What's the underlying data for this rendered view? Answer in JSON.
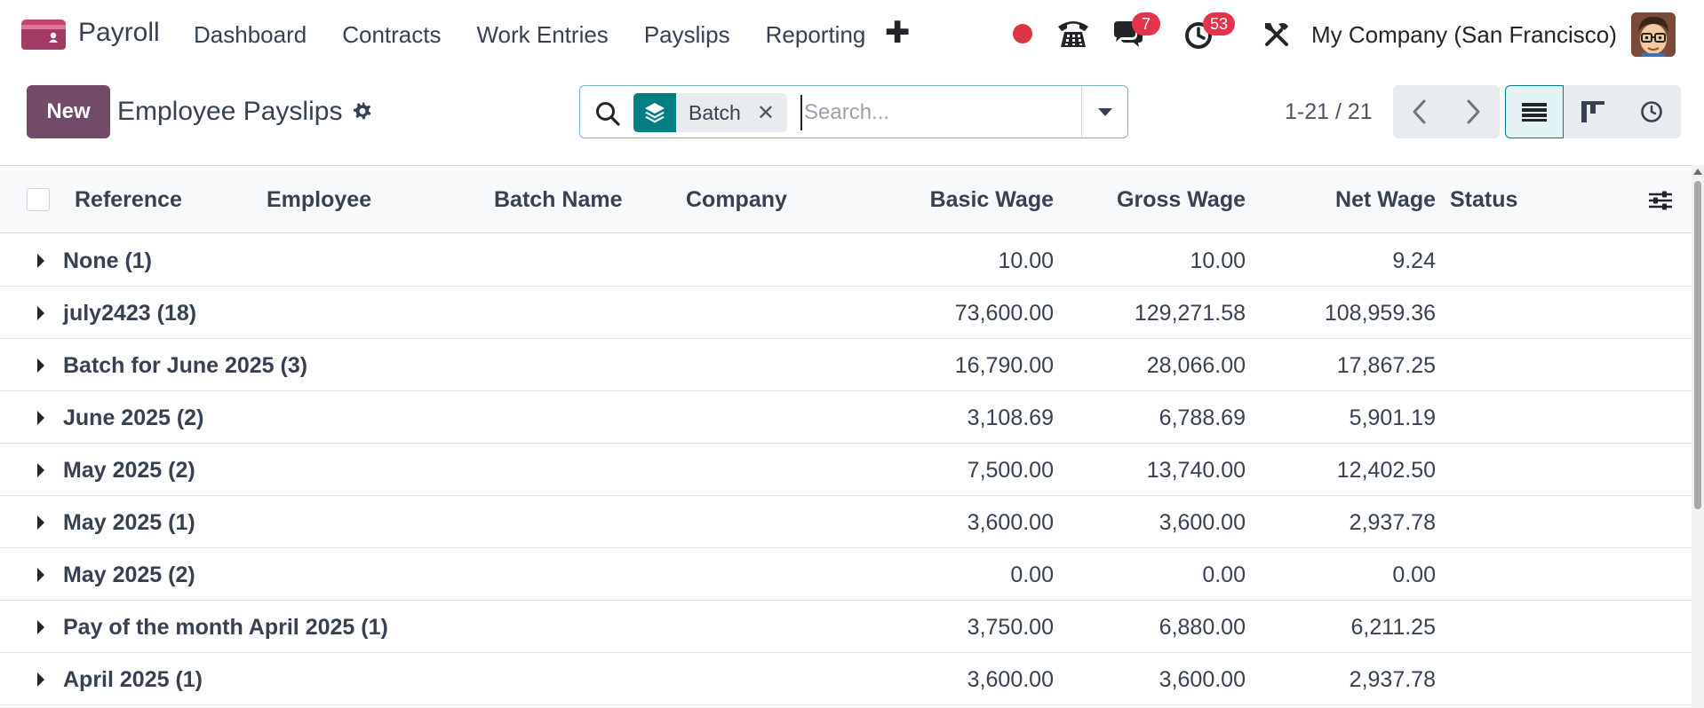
{
  "navbar": {
    "app_icon": "payroll-app-icon",
    "app_name": "Payroll",
    "menu": [
      "Dashboard",
      "Contracts",
      "Work Entries",
      "Payslips",
      "Reporting"
    ],
    "plus_icon": "✚",
    "chat_badge": "7",
    "activity_badge": "53",
    "company": "My Company (San Francisco)",
    "colors": {
      "brand": "#714b67",
      "badge": "#e4334a",
      "status_dot": "#dc3545",
      "teal": "#017e84"
    }
  },
  "control": {
    "new_label": "New",
    "title": "Employee Payslips",
    "search": {
      "facet_icon": "layers-icon",
      "facet_label": "Batch",
      "facet_remove": "✕",
      "placeholder": "Search..."
    },
    "pager": "1-21 / 21"
  },
  "table": {
    "columns": {
      "reference": "Reference",
      "employee": "Employee",
      "batch_name": "Batch Name",
      "company": "Company",
      "basic_wage": "Basic Wage",
      "gross_wage": "Gross Wage",
      "net_wage": "Net Wage",
      "status": "Status"
    },
    "groups": [
      {
        "name": "None (1)",
        "basic": "10.00",
        "gross": "10.00",
        "net": "9.24"
      },
      {
        "name": "july2423 (18)",
        "basic": "73,600.00",
        "gross": "129,271.58",
        "net": "108,959.36"
      },
      {
        "name": "Batch for June 2025 (3)",
        "basic": "16,790.00",
        "gross": "28,066.00",
        "net": "17,867.25"
      },
      {
        "name": "June 2025 (2)",
        "basic": "3,108.69",
        "gross": "6,788.69",
        "net": "5,901.19"
      },
      {
        "name": "May 2025 (2)",
        "basic": "7,500.00",
        "gross": "13,740.00",
        "net": "12,402.50"
      },
      {
        "name": "May 2025 (1)",
        "basic": "3,600.00",
        "gross": "3,600.00",
        "net": "2,937.78"
      },
      {
        "name": "May 2025 (2)",
        "basic": "0.00",
        "gross": "0.00",
        "net": "0.00"
      },
      {
        "name": "Pay of the month April 2025 (1)",
        "basic": "3,750.00",
        "gross": "6,880.00",
        "net": "6,211.25"
      },
      {
        "name": "April 2025 (1)",
        "basic": "3,600.00",
        "gross": "3,600.00",
        "net": "2,937.78"
      }
    ]
  }
}
